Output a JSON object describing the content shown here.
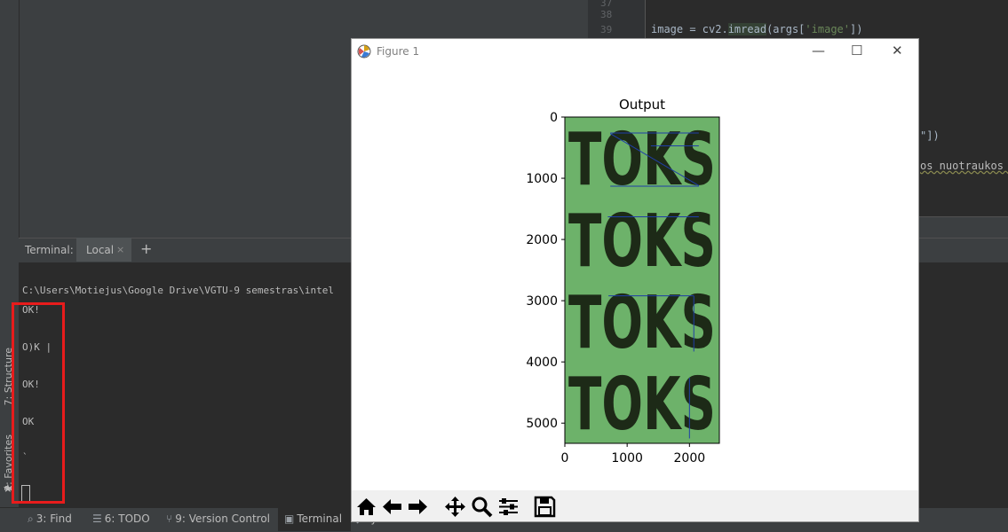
{
  "editor": {
    "line_numbers": [
      "37",
      "38",
      "39"
    ],
    "line39": {
      "a": "image = cv2.",
      "fn": "imread",
      "b": "(args[",
      "str": "'image'",
      "c": "])"
    },
    "fragment1": "\"])",
    "fragment2": "os nuotraukos ;"
  },
  "left_strip": {
    "structure_label": "7: Structure",
    "favorites_label": "2: Favorites"
  },
  "terminal": {
    "header_label": "Terminal:",
    "tab_local": "Local",
    "tab_close": "×",
    "add_tab": "+",
    "path_line": "C:\\Users\\Motiejus\\Google Drive\\VGTU-9 semestras\\intel",
    "output_lines": [
      "OK!",
      "O)K |",
      "OK!",
      "OK",
      "`"
    ]
  },
  "bottom_bar": {
    "find": "3: Find",
    "todo": "6: TODO",
    "version_control": "9: Version Control",
    "terminal": "Terminal",
    "python_console": "Python Console"
  },
  "figure": {
    "window_title": "Figure 1",
    "minimize": "—",
    "maximize": "☐",
    "close": "✕",
    "toolbar_icons": [
      "home-icon",
      "back-arrow-icon",
      "forward-arrow-icon",
      "pan-icon",
      "zoom-icon",
      "configure-subplots-icon",
      "save-icon"
    ]
  },
  "chart_data": {
    "type": "image",
    "title": "Output",
    "image_text": [
      "TOKS",
      "TOKS",
      "TOKS",
      "TOKS"
    ],
    "x_ticks": [
      "0",
      "1000",
      "2000"
    ],
    "y_ticks": [
      "0",
      "1000",
      "2000",
      "3000",
      "4000",
      "5000"
    ],
    "xlim": [
      0,
      2480
    ],
    "ylim": [
      5330,
      0
    ],
    "background_color": "#6db26a",
    "line_color": "#1f3ea8",
    "line_segments": [
      {
        "x": [
          730,
          2150
        ],
        "y": [
          260,
          260
        ]
      },
      {
        "x": [
          1380,
          2150
        ],
        "y": [
          470,
          470
        ]
      },
      {
        "x": [
          730,
          2150
        ],
        "y": [
          1130,
          1130
        ]
      },
      {
        "x": [
          690,
          2150
        ],
        "y": [
          1630,
          1630
        ]
      },
      {
        "x": [
          700,
          2070
        ],
        "y": [
          2920,
          2920
        ]
      },
      {
        "x": [
          2070,
          2070
        ],
        "y": [
          2920,
          3830
        ]
      },
      {
        "x": [
          2000,
          2000
        ],
        "y": [
          4260,
          5250
        ]
      },
      {
        "x": [
          730,
          2150
        ],
        "y": [
          270,
          1120
        ]
      }
    ]
  },
  "colors": {
    "ide_bg": "#3c3f41",
    "terminal_bg": "#2b2b2b",
    "highlight_box": "#e81c1c"
  }
}
